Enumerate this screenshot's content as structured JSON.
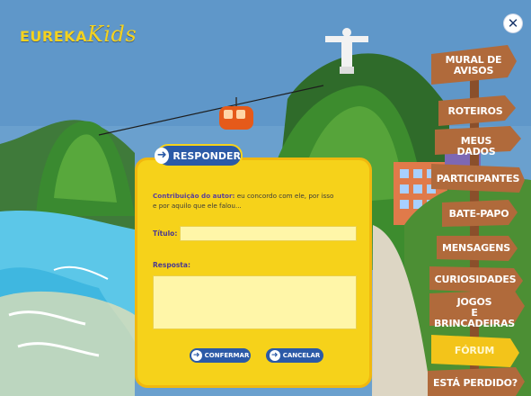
{
  "app": {
    "logo_prefix": "EUREKA",
    "logo_suffix": "Kids",
    "close_symbol": "✕"
  },
  "nav": {
    "items": [
      {
        "line1": "MURAL DE",
        "line2": "AVISOS"
      },
      {
        "line1": "ROTEIROS",
        "line2": ""
      },
      {
        "line1": "MEUS DADOS",
        "line2": ""
      },
      {
        "line1": "PARTICIPANTES",
        "line2": ""
      },
      {
        "line1": "BATE-PAPO",
        "line2": ""
      },
      {
        "line1": "MENSAGENS",
        "line2": ""
      },
      {
        "line1": "CURIOSIDADES",
        "line2": ""
      },
      {
        "line1": "JOGOS",
        "line2": "E BRINCADEIRAS"
      },
      {
        "line1": "FÓRUM",
        "line2": ""
      },
      {
        "line1": "ESTÁ PERDIDO?",
        "line2": ""
      }
    ]
  },
  "form": {
    "tab_label": "RESPONDER",
    "contribution_label": "Contribuição do autor:",
    "contribution_text_line1": "eu concordo com ele, por isso",
    "contribution_text_line2": "e por aquilo que ele falou...",
    "title_label": "Título:",
    "title_value": "",
    "reply_label": "Resposta:",
    "reply_value": "",
    "confirm_label": "CONFERMAR",
    "cancel_label": "CANCELAR"
  },
  "colors": {
    "sky": "#6aa0ce",
    "panel_yellow": "#f6d21a",
    "button_blue": "#2b5aa7",
    "sign_brown": "#b06a3b",
    "forum_sign": "#f3c41a"
  },
  "icons": {
    "responder": "arrow-right-icon",
    "confirm": "arrow-right-icon",
    "cancel": "arrow-right-icon",
    "close": "close-icon"
  }
}
